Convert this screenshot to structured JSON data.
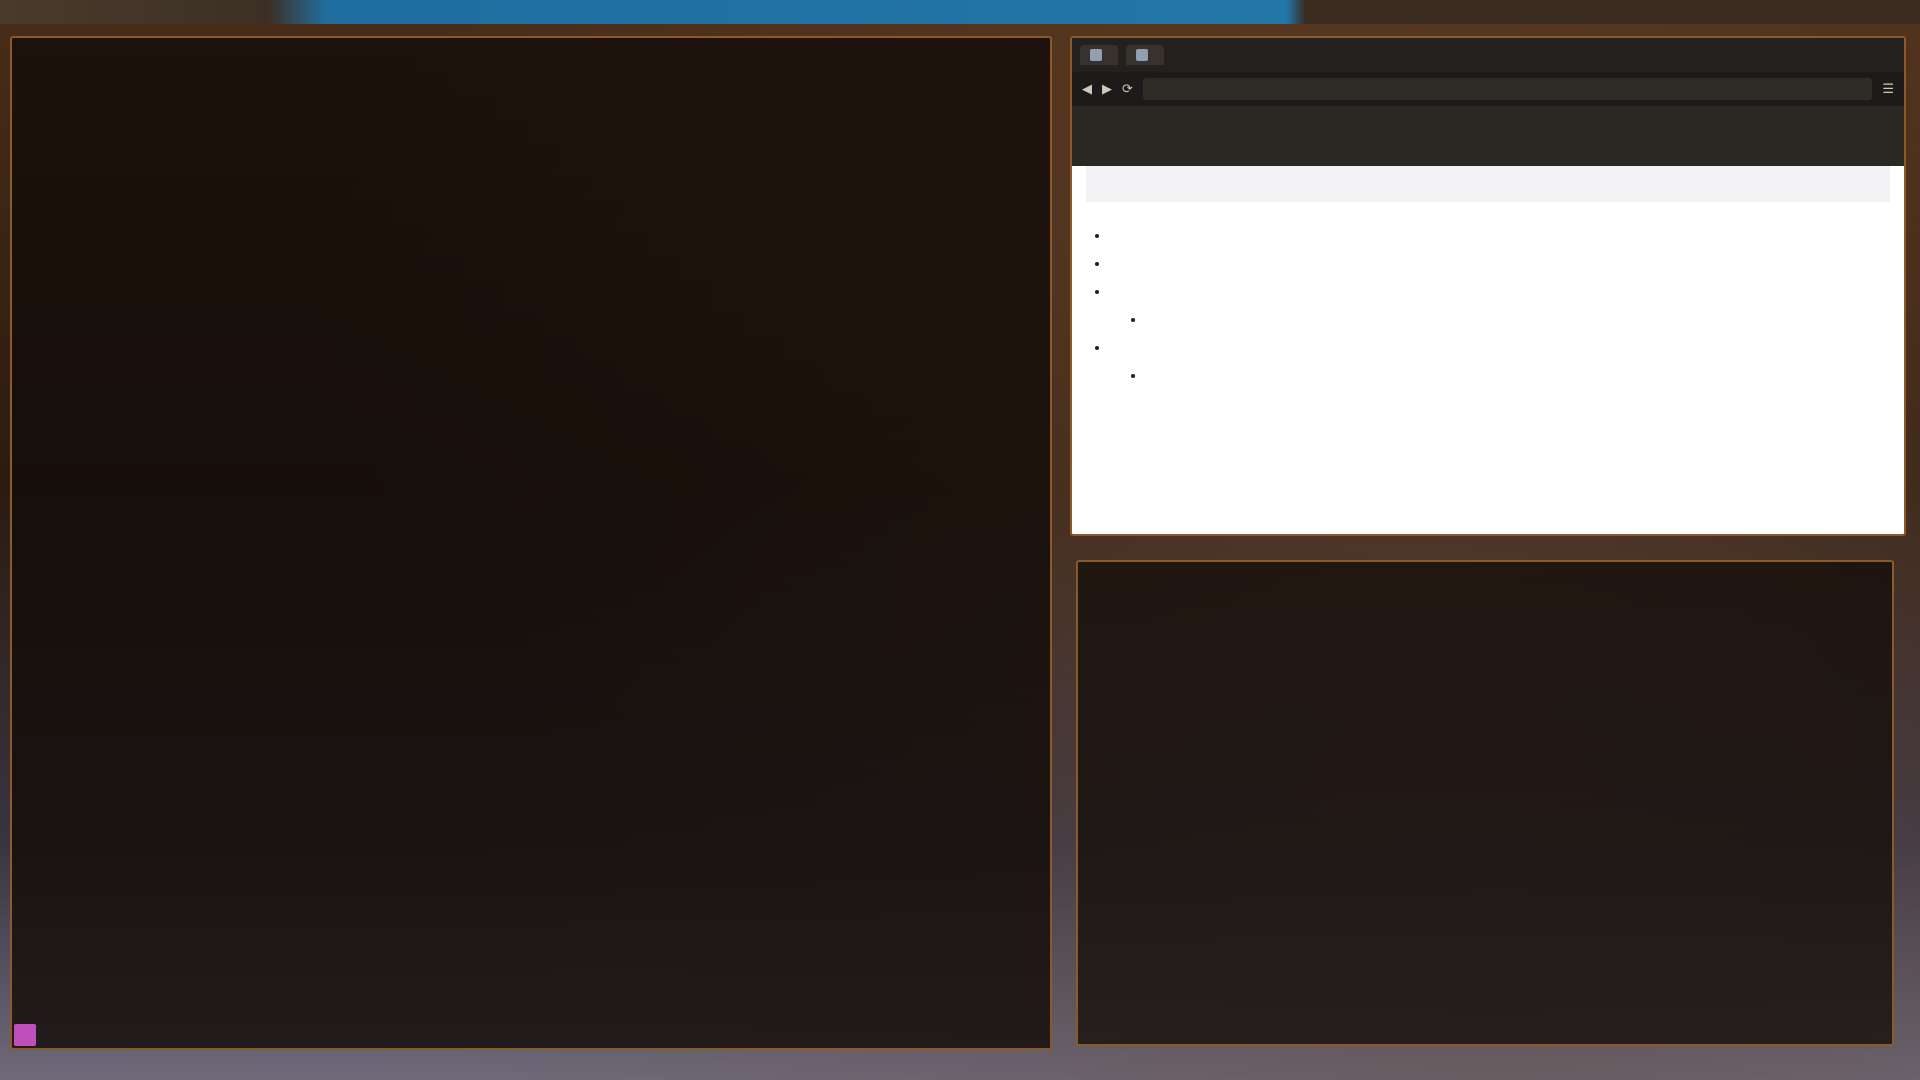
{
  "topbar": {
    "workspaces": [
      "",
      "",
      ""
    ],
    "active_title": "",
    "status": ""
  },
  "left_terminal": {
    "lines": []
  },
  "browser": {
    "tabs": [
      {
        "label": ""
      },
      {
        "label": ""
      }
    ],
    "url": "",
    "page": {
      "breadcrumb": "",
      "title": "",
      "bullets": [
        {
          "text": "",
          "link": ""
        },
        {
          "text": "",
          "link": ""
        }
      ],
      "section_link": "",
      "list": [
        {
          "text": ""
        },
        {
          "text": "",
          "indent": true
        },
        {
          "text": ""
        },
        {
          "text": "",
          "indent": true
        }
      ]
    }
  },
  "right_terminal": {
    "lines": [],
    "footer": ""
  }
}
